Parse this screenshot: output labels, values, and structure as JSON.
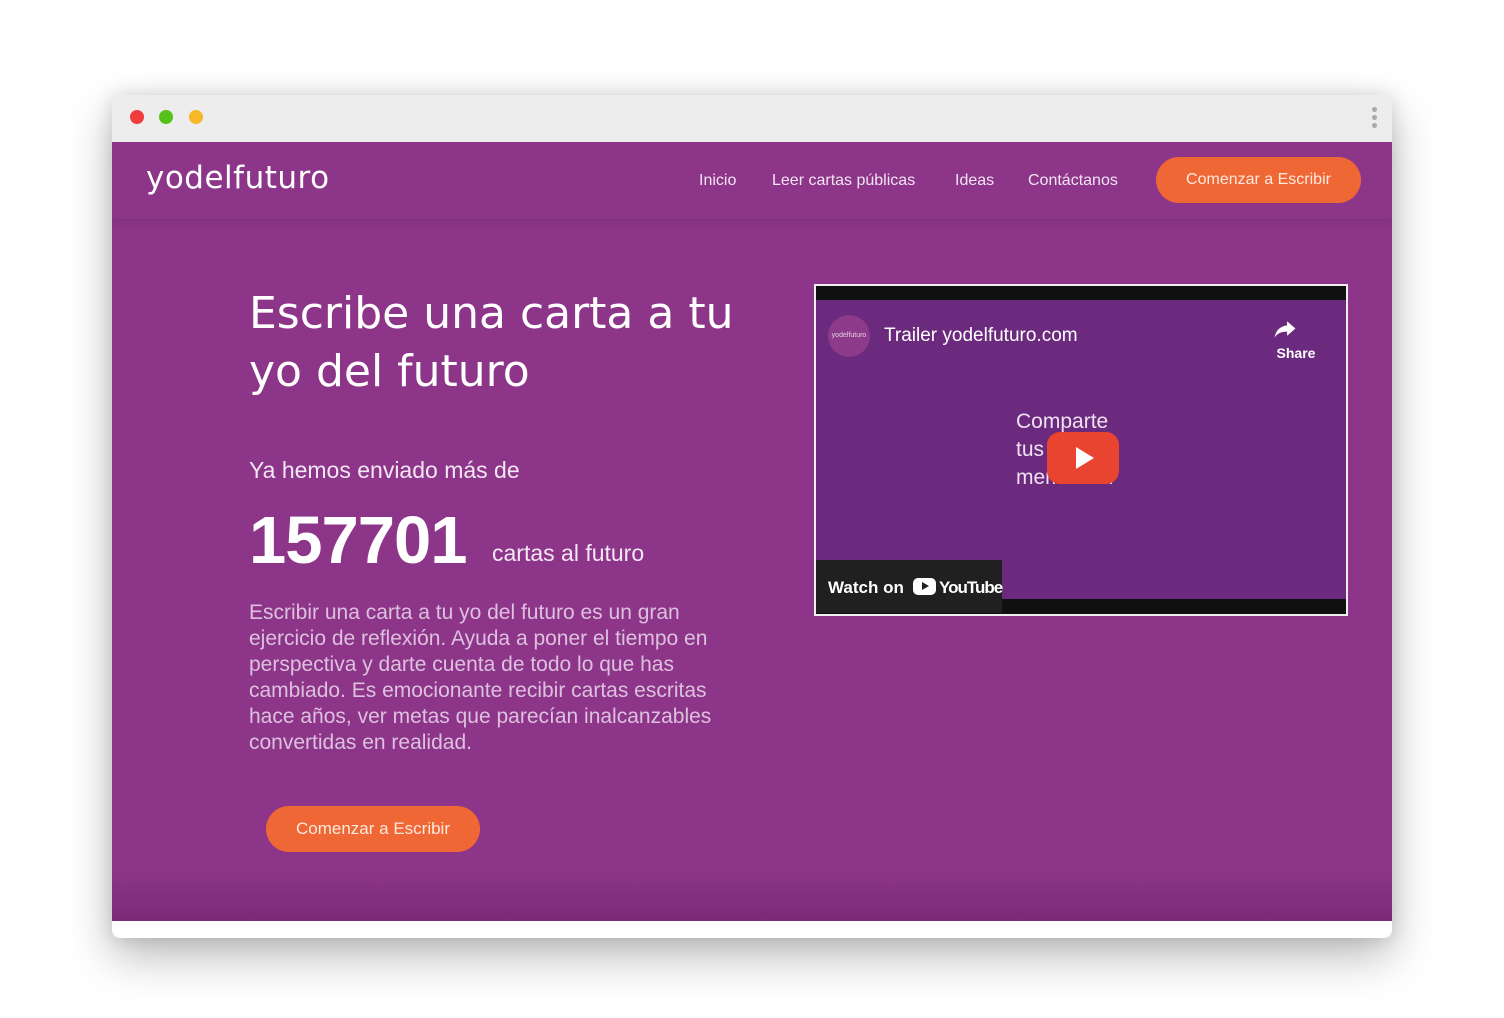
{
  "navbar": {
    "logo": "yodelfuturo",
    "links": [
      "Inicio",
      "Leer cartas públicas",
      "Ideas",
      "Contáctanos"
    ],
    "cta_label": "Comenzar a Escribir"
  },
  "hero": {
    "title_line1": "Escribe una carta a tu",
    "title_line2": "yo del futuro",
    "intro": "Ya hemos enviado más de",
    "count": "157701",
    "count_suffix": "cartas al futuro",
    "description": "Escribir una carta a tu yo del futuro es un gran ejercicio de reflexión. Ayuda a poner el tiempo en perspectiva y darte cuenta de todo lo que has cambiado. Es emocionante recibir cartas escritas hace años, ver metas que parecían inalcanzables convertidas en realidad.",
    "cta_label": "Comenzar a Escribir"
  },
  "video": {
    "channel_avatar_text": "yodelfuturo",
    "title": "Trailer yodelfuturo.com",
    "share_label": "Share",
    "overlay_line1": "Comparte",
    "overlay_line2": "tus",
    "overlay_line3": "memorias.",
    "watch_label": "Watch on",
    "youtube_label": "YouTube"
  },
  "colors": {
    "page_purple": "#8d3689",
    "accent_orange": "#ef6734",
    "video_purple": "#6b2a7d",
    "youtube_red": "#e9442f"
  },
  "icons": [
    "share-icon",
    "play-icon",
    "youtube-icon",
    "menu-dots-icon"
  ]
}
